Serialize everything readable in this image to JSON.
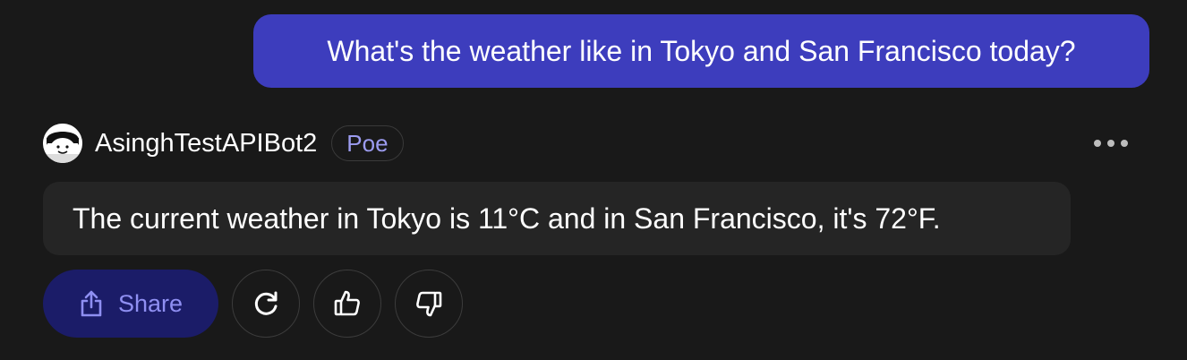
{
  "conversation": {
    "user_message": "What's the weather like in Tokyo and San Francisco today?",
    "bot": {
      "name": "AsinghTestAPIBot2",
      "badge": "Poe",
      "avatar_icon": "smiling-face-avatar",
      "message": "The current weather in Tokyo is 11°C and in San Francisco, it's 72°F."
    }
  },
  "actions": {
    "share_label": "Share",
    "share_icon": "share-upload-icon",
    "retry_icon": "refresh-icon",
    "like_icon": "thumbs-up-icon",
    "dislike_icon": "thumbs-down-icon",
    "more_icon": "ellipsis-icon"
  },
  "colors": {
    "background": "#191919",
    "user_bubble": "#3d3dbd",
    "bot_bubble": "#252525",
    "share_button": "#1b1c68",
    "accent_text": "#9c9cf0"
  }
}
